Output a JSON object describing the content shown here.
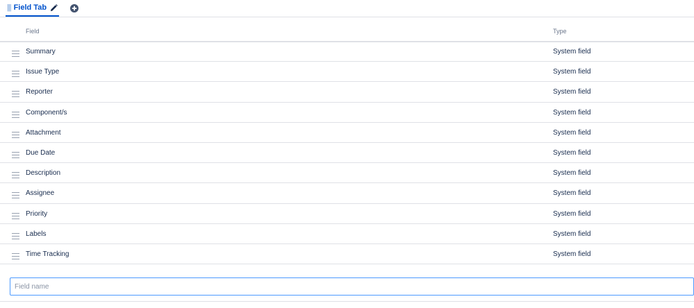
{
  "tabs": [
    {
      "label": "Field Tab",
      "icon": "pencil-icon"
    }
  ],
  "add_tab_icon": "plus-circle-icon",
  "table": {
    "columns": [
      "Field",
      "Type"
    ],
    "rows": [
      {
        "field": "Summary",
        "type": "System field"
      },
      {
        "field": "Issue Type",
        "type": "System field"
      },
      {
        "field": "Reporter",
        "type": "System field"
      },
      {
        "field": "Component/s",
        "type": "System field"
      },
      {
        "field": "Attachment",
        "type": "System field"
      },
      {
        "field": "Due Date",
        "type": "System field"
      },
      {
        "field": "Description",
        "type": "System field"
      },
      {
        "field": "Assignee",
        "type": "System field"
      },
      {
        "field": "Priority",
        "type": "System field"
      },
      {
        "field": "Labels",
        "type": "System field"
      },
      {
        "field": "Time Tracking",
        "type": "System field"
      }
    ]
  },
  "field_input": {
    "value": "",
    "placeholder": "Field name"
  },
  "colors": {
    "accent": "#0052cc",
    "border": "#dfe1e6",
    "input_focus": "#4c9aff",
    "muted_text": "#6b778c"
  }
}
